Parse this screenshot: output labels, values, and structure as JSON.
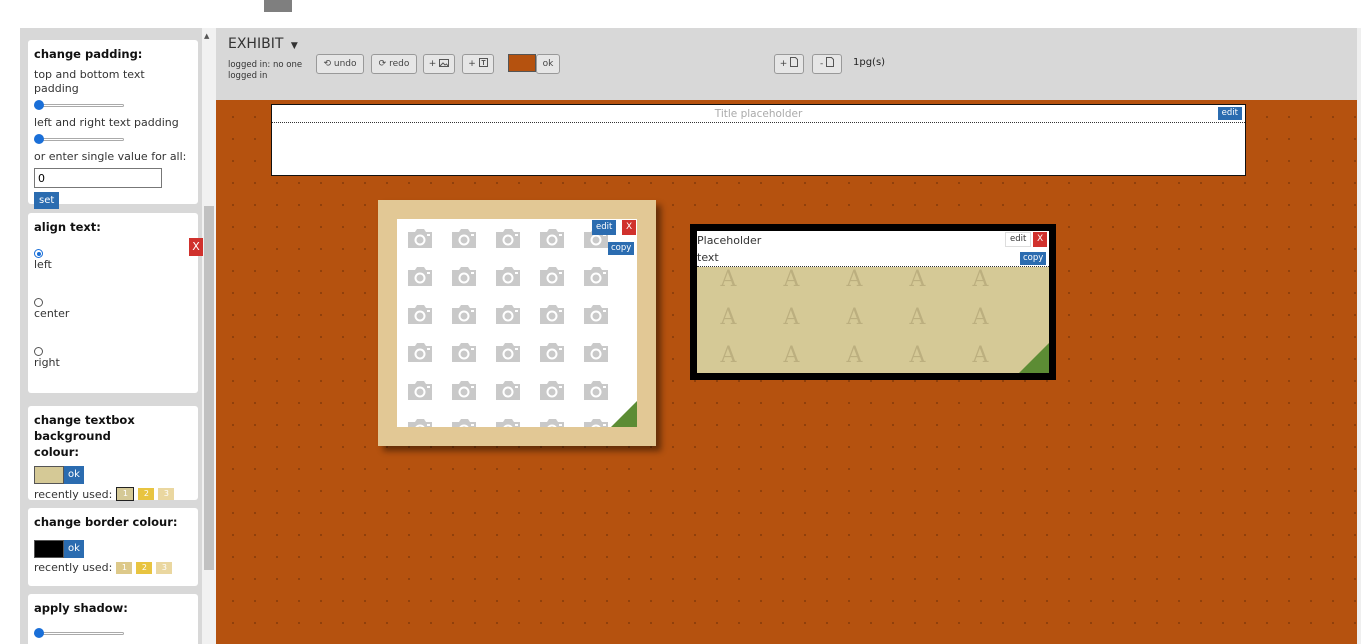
{
  "sidebar": {
    "padding": {
      "title": "change padding:",
      "top_bottom_label": "top and bottom text padding",
      "left_right_label": "left and right text padding",
      "single_value_label": "or enter single value for all:",
      "single_value": "0",
      "set_label": "set"
    },
    "align": {
      "title": "align text:",
      "options": [
        {
          "label": "left",
          "checked": true
        },
        {
          "label": "center",
          "checked": false
        },
        {
          "label": "right",
          "checked": false
        }
      ]
    },
    "bg_colour": {
      "title": "change textbox background colour:",
      "ok_label": "ok",
      "recent_label": "recently used:",
      "swatch": "#d5c996",
      "recent": [
        {
          "label": "1",
          "color": "#d5c996"
        },
        {
          "label": "2",
          "color": "#e8c440"
        },
        {
          "label": "3",
          "color": "#ead7a0"
        }
      ]
    },
    "border_colour": {
      "title": "change border colour:",
      "ok_label": "ok",
      "recent_label": "recently used:",
      "swatch": "#000000",
      "recent": [
        {
          "label": "1",
          "color": "#ddc98a"
        },
        {
          "label": "2",
          "color": "#e8c440"
        },
        {
          "label": "3",
          "color": "#ead7a0"
        }
      ]
    },
    "shadow": {
      "title": "apply shadow:"
    },
    "close_label": "X"
  },
  "toolbar": {
    "app_title": "EXHIBIT",
    "logged_in": "logged in: no one logged in",
    "undo_label": "undo",
    "redo_label": "redo",
    "add_image_label": "+",
    "add_text_label": "+",
    "ok_label": "ok",
    "canvas_color": "#b5520f",
    "add_page_label": "+",
    "remove_page_label": "-",
    "pages_label": "1pg(s)"
  },
  "canvas": {
    "title_placeholder": "Title placeholder",
    "title_edit_label": "edit",
    "image_box": {
      "edit_label": "edit",
      "delete_label": "X",
      "copy_label": "copy"
    },
    "text_box": {
      "line1": "Placeholder",
      "line2": "text",
      "edit_label": "edit",
      "delete_label": "X",
      "copy_label": "copy"
    }
  },
  "colors": {
    "accent": "#2b6cb0",
    "danger": "#d0312d",
    "canvas_bg": "#b5520f",
    "frame": "#e2c895",
    "resize_handle": "#5c8c34"
  },
  "icons": [
    "camera-icon",
    "undo-icon",
    "redo-icon",
    "image-icon",
    "text-icon",
    "page-icon",
    "dropdown-icon",
    "resize-handle-icon"
  ]
}
